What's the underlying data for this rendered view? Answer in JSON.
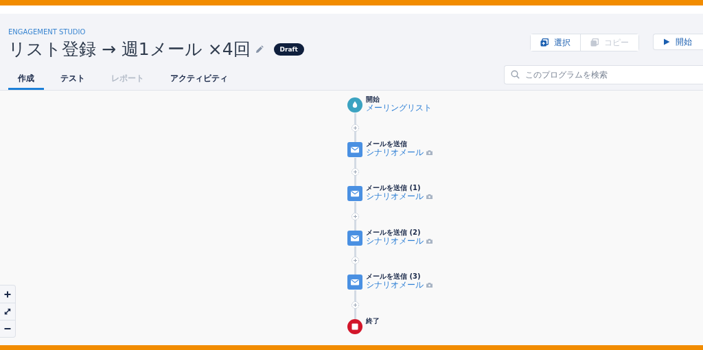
{
  "app_label": "ENGAGEMENT STUDIO",
  "title": "リスト登録 → 週1メール ×4回",
  "status_badge": "Draft",
  "tabs": [
    {
      "label": "作成",
      "selected": true,
      "disabled": false
    },
    {
      "label": "テスト",
      "selected": false,
      "disabled": false
    },
    {
      "label": "レポート",
      "selected": false,
      "disabled": true
    },
    {
      "label": "アクティビティ",
      "selected": false,
      "disabled": false
    }
  ],
  "toolbar": [
    {
      "kind": "select",
      "label": "選択",
      "disabled": false
    },
    {
      "kind": "copy",
      "label": "コピー",
      "disabled": true
    }
  ],
  "start_button": "開始",
  "search": {
    "placeholder": "このプログラムを検索"
  },
  "flow": [
    {
      "kind": "start",
      "title": "開始",
      "subtitle": "メーリングリスト"
    },
    {
      "kind": "email",
      "title": "メールを送信",
      "subtitle": "シナリオメール"
    },
    {
      "kind": "email",
      "title": "メールを送信 (1)",
      "subtitle": "シナリオメール"
    },
    {
      "kind": "email",
      "title": "メールを送信 (2)",
      "subtitle": "シナリオメール"
    },
    {
      "kind": "email",
      "title": "メールを送信 (3)",
      "subtitle": "シナリオメール"
    },
    {
      "kind": "end",
      "title": "終了"
    }
  ]
}
